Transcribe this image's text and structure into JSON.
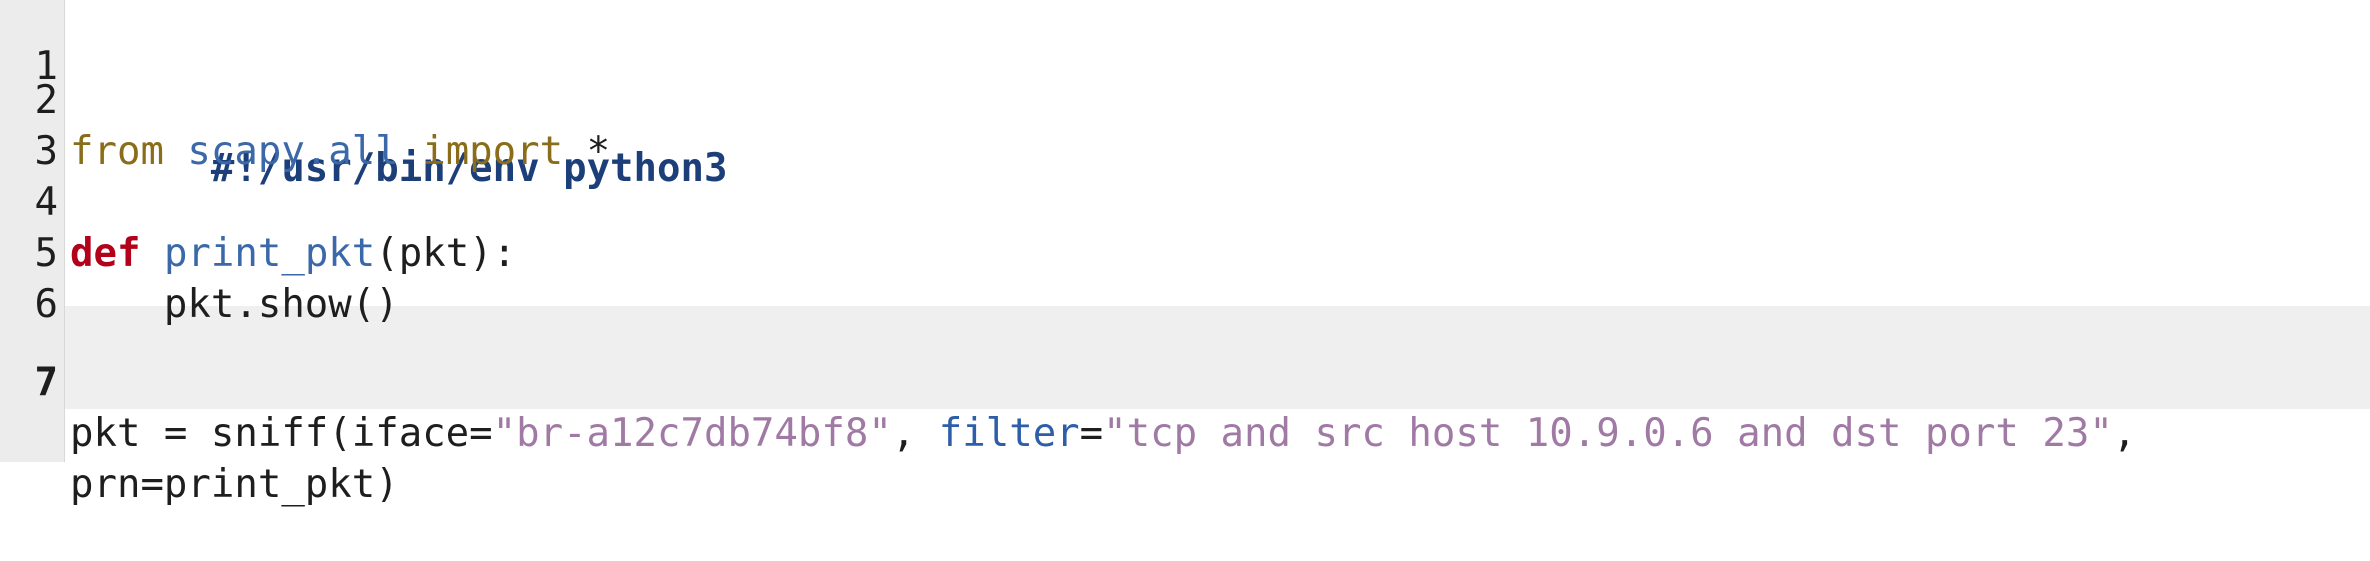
{
  "editor": {
    "language": "python",
    "current_line": 7,
    "lines": [
      {
        "number": "1",
        "tokens": [
          {
            "text": "#!/usr/bin/env python3",
            "type": "shebang"
          }
        ]
      },
      {
        "number": "2",
        "tokens": [
          {
            "text": "from",
            "type": "kw-import"
          },
          {
            "text": " ",
            "type": "plain"
          },
          {
            "text": "scapy.all",
            "type": "module"
          },
          {
            "text": " ",
            "type": "plain"
          },
          {
            "text": "import",
            "type": "kw-import"
          },
          {
            "text": " *",
            "type": "plain"
          }
        ]
      },
      {
        "number": "3",
        "tokens": []
      },
      {
        "number": "4",
        "tokens": [
          {
            "text": "def",
            "type": "kw-def"
          },
          {
            "text": " ",
            "type": "plain"
          },
          {
            "text": "print_pkt",
            "type": "fname"
          },
          {
            "text": "(pkt):",
            "type": "plain"
          }
        ]
      },
      {
        "number": "5",
        "tokens": [
          {
            "text": "    pkt.show()",
            "type": "plain"
          }
        ]
      },
      {
        "number": "6",
        "tokens": []
      },
      {
        "number": "7",
        "tokens": [
          {
            "text": "pkt = sniff(iface=",
            "type": "plain"
          },
          {
            "text": "\"br-a12c7db74bf8\"",
            "type": "str"
          },
          {
            "text": ", ",
            "type": "plain"
          },
          {
            "text": "filter",
            "type": "param-kw"
          },
          {
            "text": "=",
            "type": "plain"
          },
          {
            "text": "\"tcp and src host 10.9.0.6 and dst port 23\"",
            "type": "str"
          },
          {
            "text": ",",
            "type": "plain"
          }
        ]
      },
      {
        "number": "",
        "tokens": [
          {
            "text": "prn=print_pkt)",
            "type": "plain"
          }
        ]
      }
    ]
  }
}
